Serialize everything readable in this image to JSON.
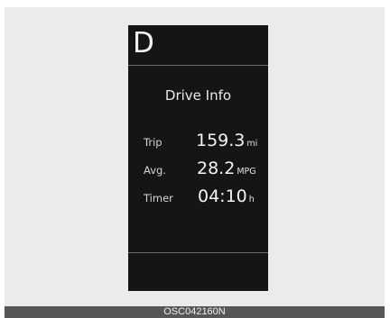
{
  "cluster": {
    "gear": "D",
    "title": "Drive Info",
    "rows": [
      {
        "label": "Trip",
        "value": "159.3",
        "unit": "mi"
      },
      {
        "label": "Avg.",
        "value": "28.2",
        "unit": "MPG"
      },
      {
        "label": "Timer",
        "value": "04:10",
        "unit": "h"
      }
    ]
  },
  "caption": "OSC042160N"
}
